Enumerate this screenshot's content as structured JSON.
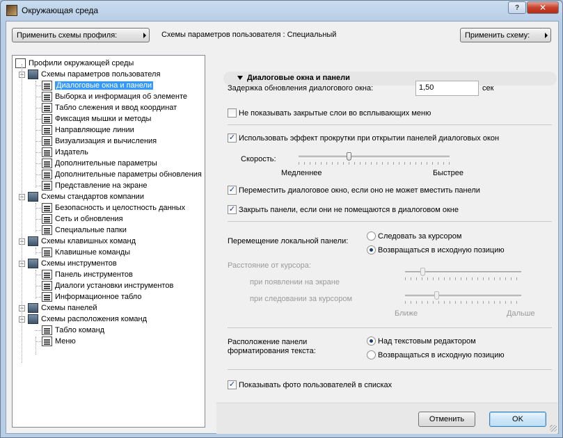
{
  "window": {
    "title": "Окружающая среда",
    "help_label": "?",
    "close_label": "✕"
  },
  "toolbar": {
    "apply_profile_label": "Применить схемы профиля:",
    "scheme_label": "Схемы параметров пользователя : Специальный",
    "apply_scheme_label": "Применить схему:"
  },
  "tree": {
    "root": "Профили окружающей среды",
    "items": [
      {
        "label": "Схемы параметров пользователя",
        "icon": "folder-icon"
      },
      {
        "label": "Диалоговые окна и панели",
        "icon": "dialog-icon"
      },
      {
        "label": "Выборка и информация об элементе",
        "icon": "selection-icon"
      },
      {
        "label": "Табло слежения и ввод координат",
        "icon": "tracker-icon"
      },
      {
        "label": "Фиксация мышки и методы",
        "icon": "mouse-icon"
      },
      {
        "label": "Направляющие линии",
        "icon": "guide-lines-icon"
      },
      {
        "label": "Визуализация и вычисления",
        "icon": "calculation-icon"
      },
      {
        "label": "Издатель",
        "icon": "publisher-icon"
      },
      {
        "label": "Дополнительные параметры",
        "icon": "more-options-icon"
      },
      {
        "label": "Дополнительные параметры обновления",
        "icon": "update-options-icon"
      },
      {
        "label": "Представление на экране",
        "icon": "display-icon"
      },
      {
        "label": "Схемы стандартов компании",
        "icon": "folder-icon"
      },
      {
        "label": "Безопасность и целостность данных",
        "icon": "safety-icon"
      },
      {
        "label": "Сеть и обновления",
        "icon": "network-icon"
      },
      {
        "label": "Специальные папки",
        "icon": "special-folder-icon"
      },
      {
        "label": "Схемы клавишных команд",
        "icon": "folder-icon"
      },
      {
        "label": "Клавишные команды",
        "icon": "shortcut-icon"
      },
      {
        "label": "Схемы инструментов",
        "icon": "folder-icon"
      },
      {
        "label": "Панель инструментов",
        "icon": "toolbox-icon"
      },
      {
        "label": "Диалоги установки инструментов",
        "icon": "tool-settings-icon"
      },
      {
        "label": "Информационное табло",
        "icon": "info-box-icon"
      },
      {
        "label": "Схемы панелей",
        "icon": "folder-icon"
      },
      {
        "label": "Схемы расположения команд",
        "icon": "folder-icon"
      },
      {
        "label": "Табло команд",
        "icon": "command-table-icon"
      },
      {
        "label": "Меню",
        "icon": "menu-icon"
      }
    ]
  },
  "panel": {
    "header": "Диалоговые окна и панели",
    "delay_label": "Задержка обновления диалогового окна:",
    "delay_value": "1,50",
    "delay_unit": "сек",
    "hide_closed_layers": {
      "label": "Не показывать закрытые слои во всплывающих меню",
      "checked": false
    },
    "scroll_effect": {
      "label": "Использовать эффект прокрутки при открытии панелей диалоговых окон",
      "checked": true
    },
    "speed_label": "Скорость:",
    "speed_slow": "Медленнее",
    "speed_fast": "Быстрее",
    "speed_level": 0.33,
    "move_dialog": {
      "label": "Переместить диалоговое окно, если оно не может вместить панели",
      "checked": true
    },
    "close_panels": {
      "label": "Закрыть панели, если они не помещаются в диалоговом окне",
      "checked": true
    },
    "local_panel_label": "Перемещение локальной панели:",
    "follow_cursor": {
      "label": "Следовать за курсором",
      "selected": false
    },
    "return_home": {
      "label": "Возвращаться в исходную позицию",
      "selected": true
    },
    "distance_label": "Расстояние от курсора:",
    "on_appear_label": "при появлении на экране",
    "on_follow_label": "при следовании за курсором",
    "closer": "Ближе",
    "farther": "Дальше",
    "appear_level": 0.15,
    "follow_level": 0.27,
    "format_panel_label_1": "Расположение панели",
    "format_panel_label_2": "форматирования текста:",
    "above_editor": {
      "label": "Над текстовым редактором",
      "selected": true
    },
    "return_home_2": {
      "label": "Возвращаться в исходную позицию",
      "selected": false
    },
    "show_photos": {
      "label": "Показывать фото пользователей в списках",
      "checked": true
    }
  },
  "buttons": {
    "cancel": "Отменить",
    "ok": "OK"
  },
  "check_mark": "✓",
  "colors": {
    "selection": "#3399ff",
    "title_bar": "#b7cde6",
    "close": "#c7412b"
  }
}
